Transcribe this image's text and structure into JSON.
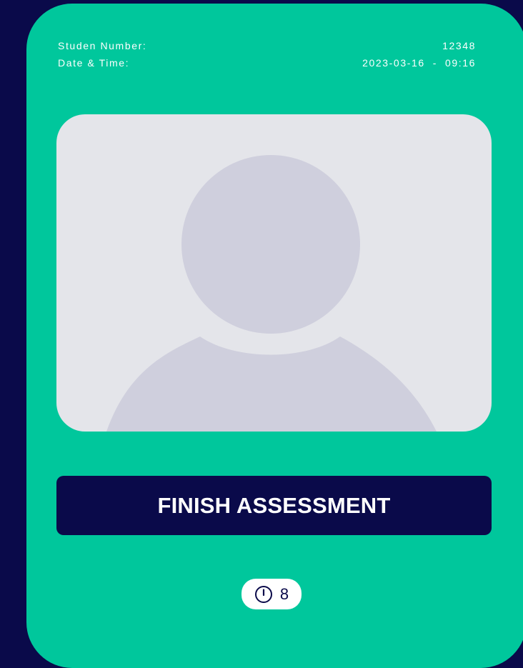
{
  "student": {
    "number_label": "Studen Number:",
    "number_value": "12348",
    "datetime_label": "Date & Time:",
    "datetime_value": "2023-03-16  -  09:16"
  },
  "photo": {
    "icon": "avatar-placeholder-icon"
  },
  "actions": {
    "finish_label": "FINISH ASSESSMENT"
  },
  "timer": {
    "icon": "clock-alert-icon",
    "value": "8"
  },
  "colors": {
    "background": "#0a0a4a",
    "card": "#00c79c",
    "photo_bg": "#e4e5ea",
    "avatar": "#cfcfdd",
    "button": "#0a0a4a",
    "text_light": "#ffffff"
  }
}
